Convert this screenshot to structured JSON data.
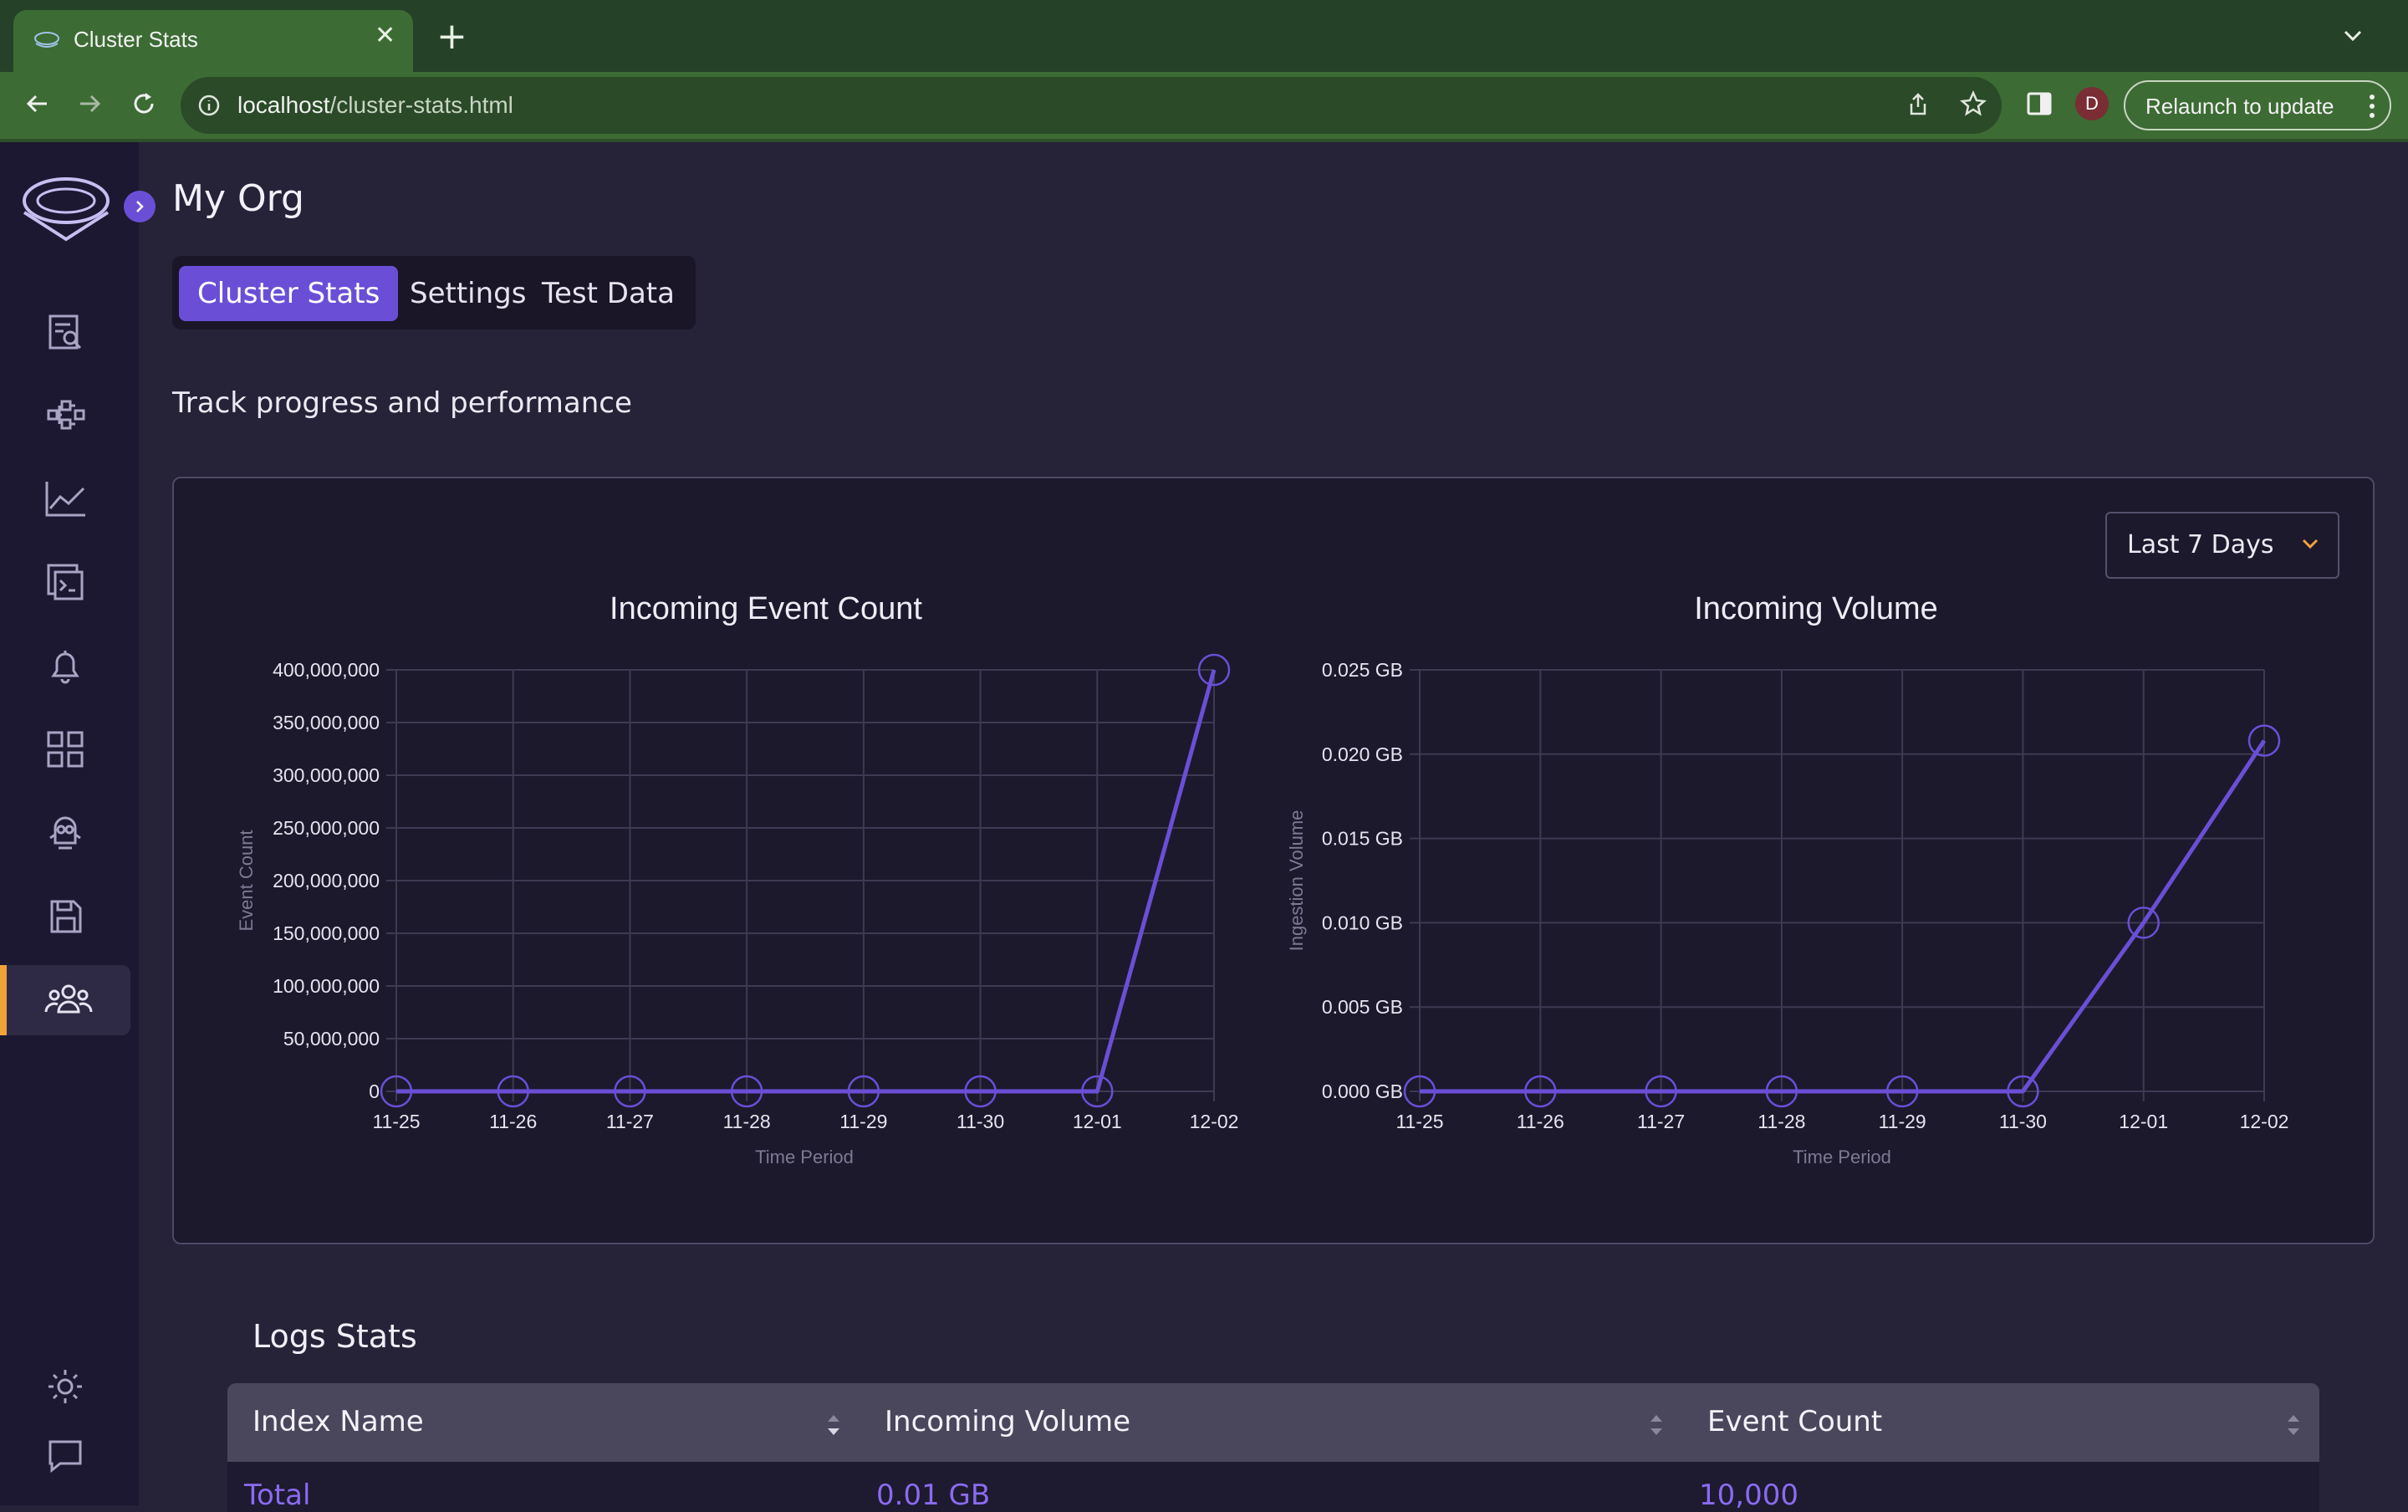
{
  "browser": {
    "tab_title": "Cluster Stats",
    "url_host": "localhost",
    "url_path": "/cluster-stats.html",
    "profile_initial": "D",
    "relaunch_label": "Relaunch to update"
  },
  "sidebar": {
    "items": [
      {
        "icon": "logs-search-icon"
      },
      {
        "icon": "pipelines-icon"
      },
      {
        "icon": "metrics-chart-icon"
      },
      {
        "icon": "traces-icon"
      },
      {
        "icon": "alerts-bell-icon"
      },
      {
        "icon": "dashboards-grid-icon"
      },
      {
        "icon": "bot-icon"
      },
      {
        "icon": "save-icon"
      },
      {
        "icon": "team-users-icon",
        "active": true
      }
    ],
    "bottom": [
      {
        "icon": "theme-sun-icon"
      },
      {
        "icon": "chat-feedback-icon"
      }
    ]
  },
  "header": {
    "org_name": "My Org",
    "tabs": [
      {
        "label": "Cluster Stats",
        "active": true
      },
      {
        "label": "Settings"
      },
      {
        "label": "Test Data"
      }
    ],
    "subtitle": "Track progress and performance"
  },
  "range": {
    "selected": "Last 7 Days"
  },
  "colors": {
    "accent": "#6a4fd6",
    "line": "#6a4fd6",
    "active_marker": "#f0a23a"
  },
  "chart_data": [
    {
      "type": "line",
      "title": "Incoming Event Count",
      "xlabel": "Time Period",
      "ylabel": "Event Count",
      "x": [
        "11-25",
        "11-26",
        "11-27",
        "11-28",
        "11-29",
        "11-30",
        "12-01",
        "12-02"
      ],
      "values": [
        0,
        0,
        0,
        0,
        0,
        0,
        0,
        400000000
      ],
      "yticks": [
        "0",
        "50,000,000",
        "100,000,000",
        "150,000,000",
        "200,000,000",
        "250,000,000",
        "300,000,000",
        "350,000,000",
        "400,000,000"
      ],
      "ylim": [
        0,
        400000000
      ],
      "grid": true
    },
    {
      "type": "line",
      "title": "Incoming Volume",
      "xlabel": "Time Period",
      "ylabel": "Ingestion Volume",
      "x": [
        "11-25",
        "11-26",
        "11-27",
        "11-28",
        "11-29",
        "11-30",
        "12-01",
        "12-02"
      ],
      "values": [
        0,
        0,
        0,
        0,
        0,
        0,
        0.01,
        0.0208
      ],
      "yticks": [
        "0.000 GB",
        "0.005 GB",
        "0.010 GB",
        "0.015 GB",
        "0.020 GB",
        "0.025 GB"
      ],
      "ylim": [
        0,
        0.025
      ],
      "grid": true
    }
  ],
  "logs": {
    "title": "Logs Stats",
    "columns": [
      "Index Name",
      "Incoming Volume",
      "Event Count"
    ],
    "rows": [
      [
        "Total",
        "0.01 GB",
        "10,000"
      ]
    ]
  }
}
